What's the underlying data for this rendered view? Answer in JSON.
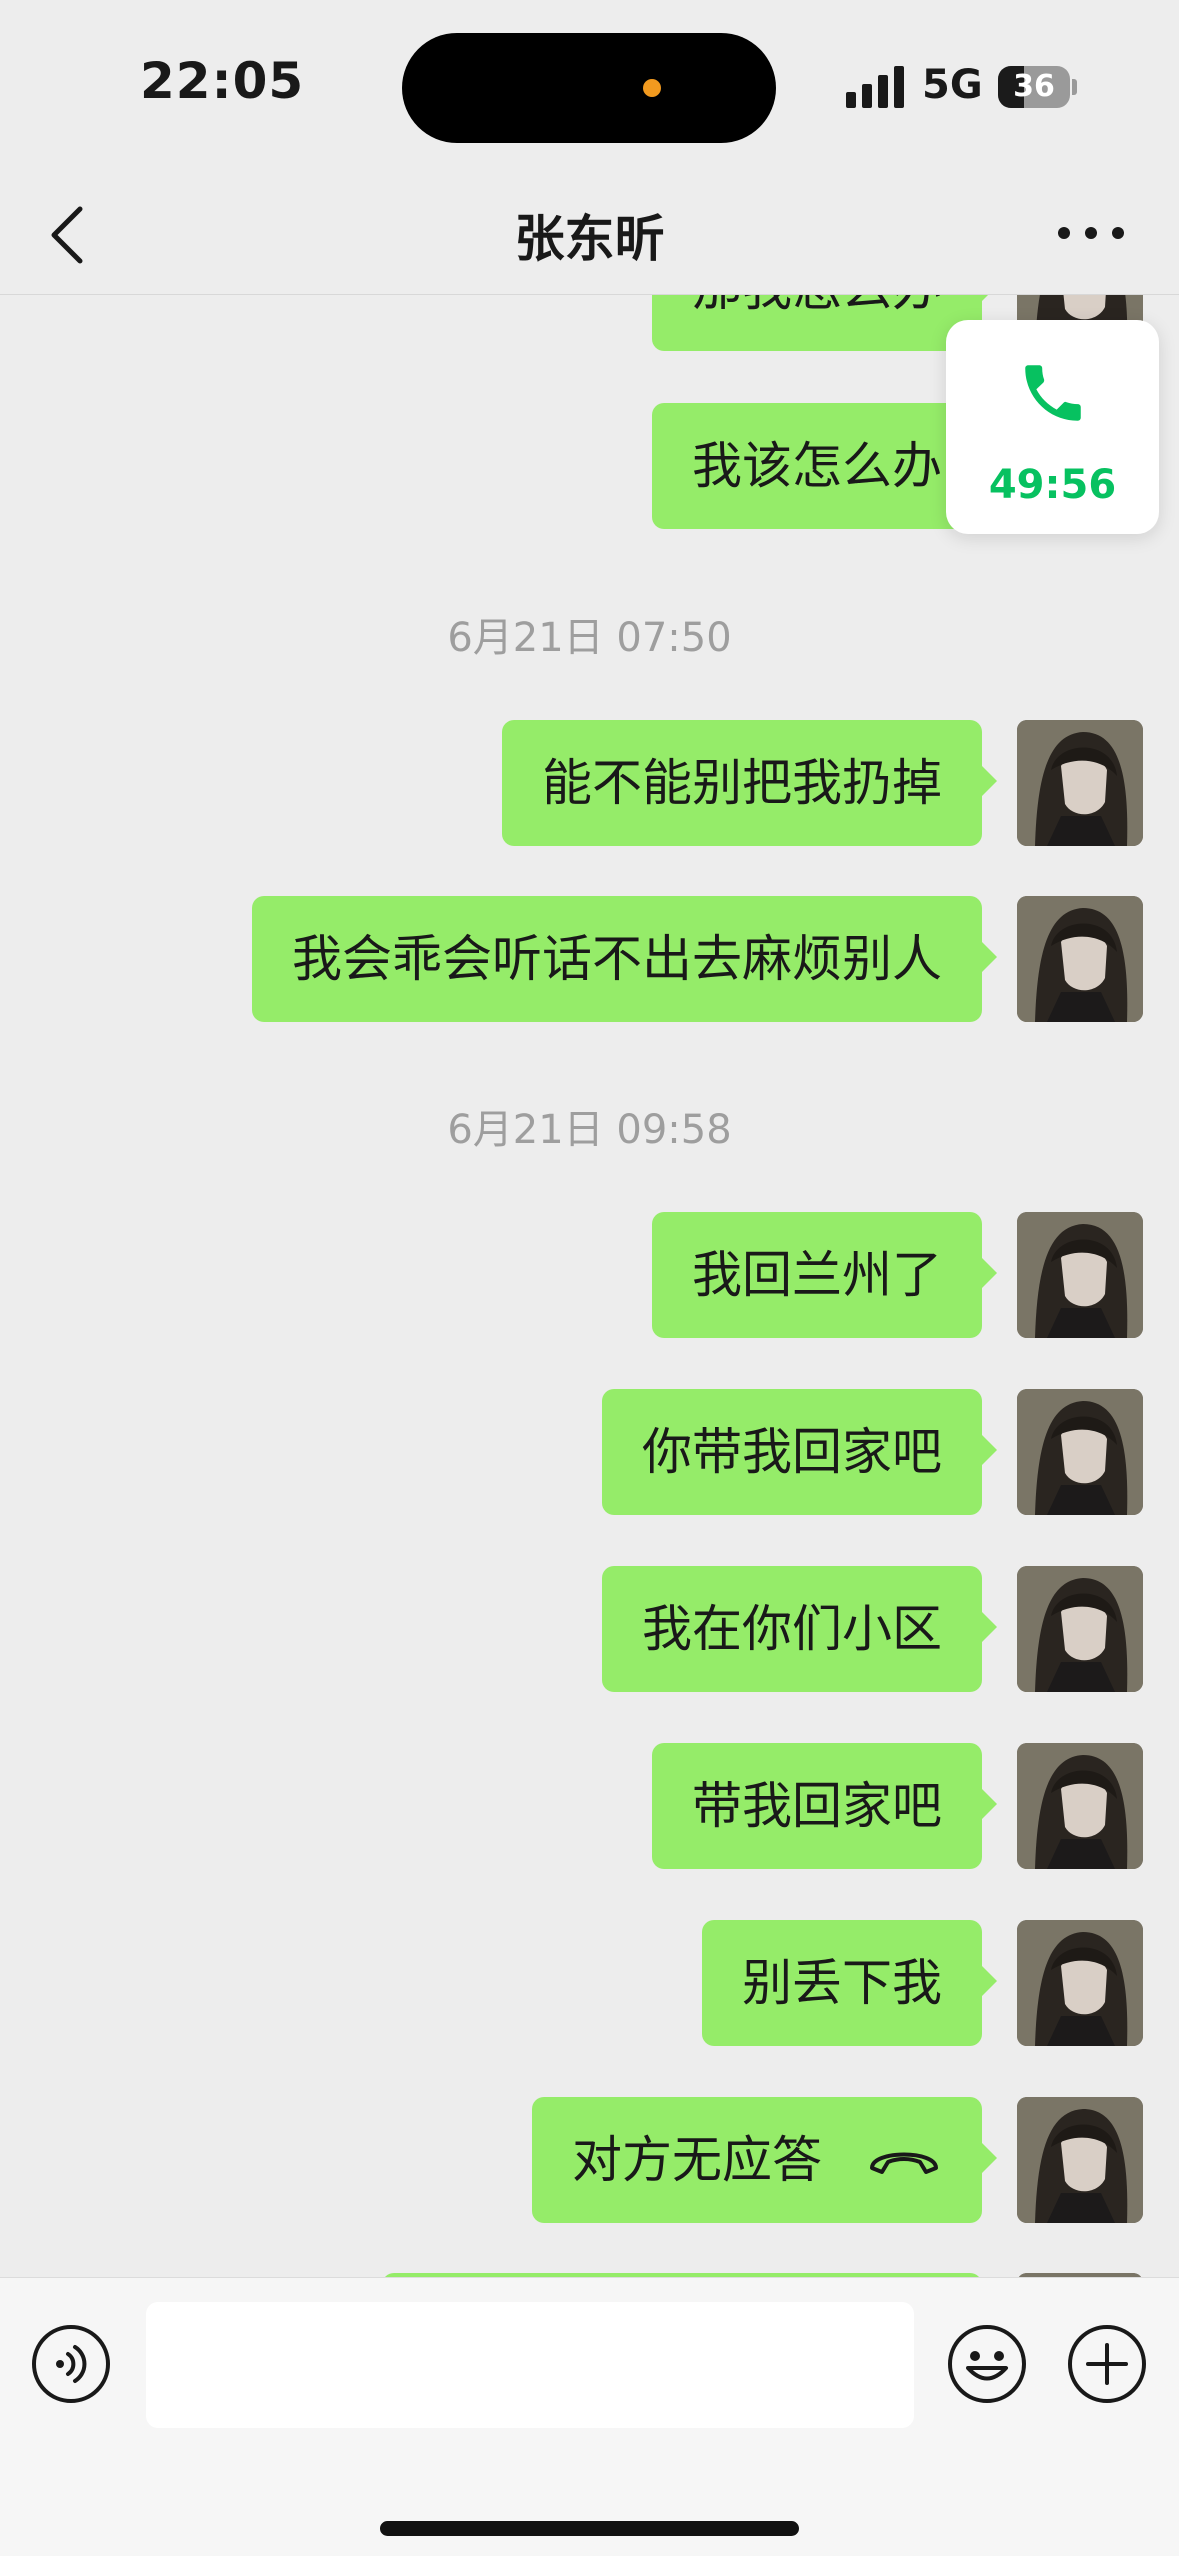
{
  "status_bar": {
    "time": "22:05",
    "network": "5G",
    "battery": "36",
    "battery_level": 0.36
  },
  "nav": {
    "title": "张东昕",
    "back_icon": "chevron-left-icon",
    "more_icon": "ellipsis-icon"
  },
  "call_widget": {
    "icon": "phone-icon",
    "timer": "49:56",
    "accent": "#07c160"
  },
  "chat": {
    "partial_message": "那我怎么办",
    "messages_top": [
      "我该怎么办"
    ],
    "timestamp_1": "6月21日 07:50",
    "messages_mid": [
      "能不能别把我扔掉",
      "我会乖会听话不出去麻烦别人"
    ],
    "timestamp_2": "6月21日 09:58",
    "messages_bottom": [
      "我回兰州了",
      "你带我回家吧",
      "我在你们小区",
      "带我回家吧",
      "别丢下我"
    ],
    "call_message": {
      "text": "对方无应答",
      "icon": "hang-up-icon"
    },
    "bubble_color": "#95ec69"
  },
  "input_bar": {
    "voice_icon": "voice-icon",
    "emoji_icon": "emoji-icon",
    "plus_icon": "plus-icon",
    "value": ""
  }
}
